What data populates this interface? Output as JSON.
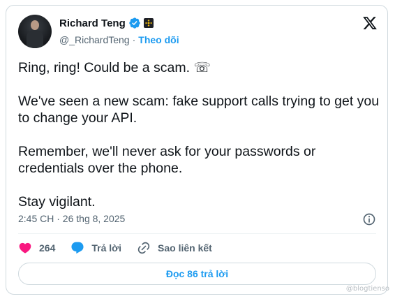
{
  "author": {
    "display_name": "Richard Teng",
    "handle": "@_RichardTeng",
    "separator": "·",
    "follow_label": "Theo dõi"
  },
  "tweet": {
    "paragraphs": [
      "Ring, ring! Could be a scam. ☏",
      "We've seen a new scam: fake support calls trying to get you to change your API.",
      "Remember, we'll never ask for your passwords or credentials over the phone.",
      "Stay vigilant."
    ],
    "timestamp": "2:45 CH · 26 thg 8, 2025"
  },
  "actions": {
    "like_count": "264",
    "reply_label": "Trả lời",
    "copy_link_label": "Sao liên kết"
  },
  "read_replies_label": "Đọc 86 trả lời",
  "watermark": "@blogtienso",
  "colors": {
    "accent": "#1d9bf0",
    "like": "#f91880",
    "text": "#0f1419",
    "muted": "#536471",
    "border": "#cfd9de"
  },
  "icons": [
    "verified-badge-icon",
    "binance-affiliate-icon",
    "x-logo-icon",
    "info-icon",
    "heart-icon",
    "reply-bubble-icon",
    "link-icon"
  ]
}
